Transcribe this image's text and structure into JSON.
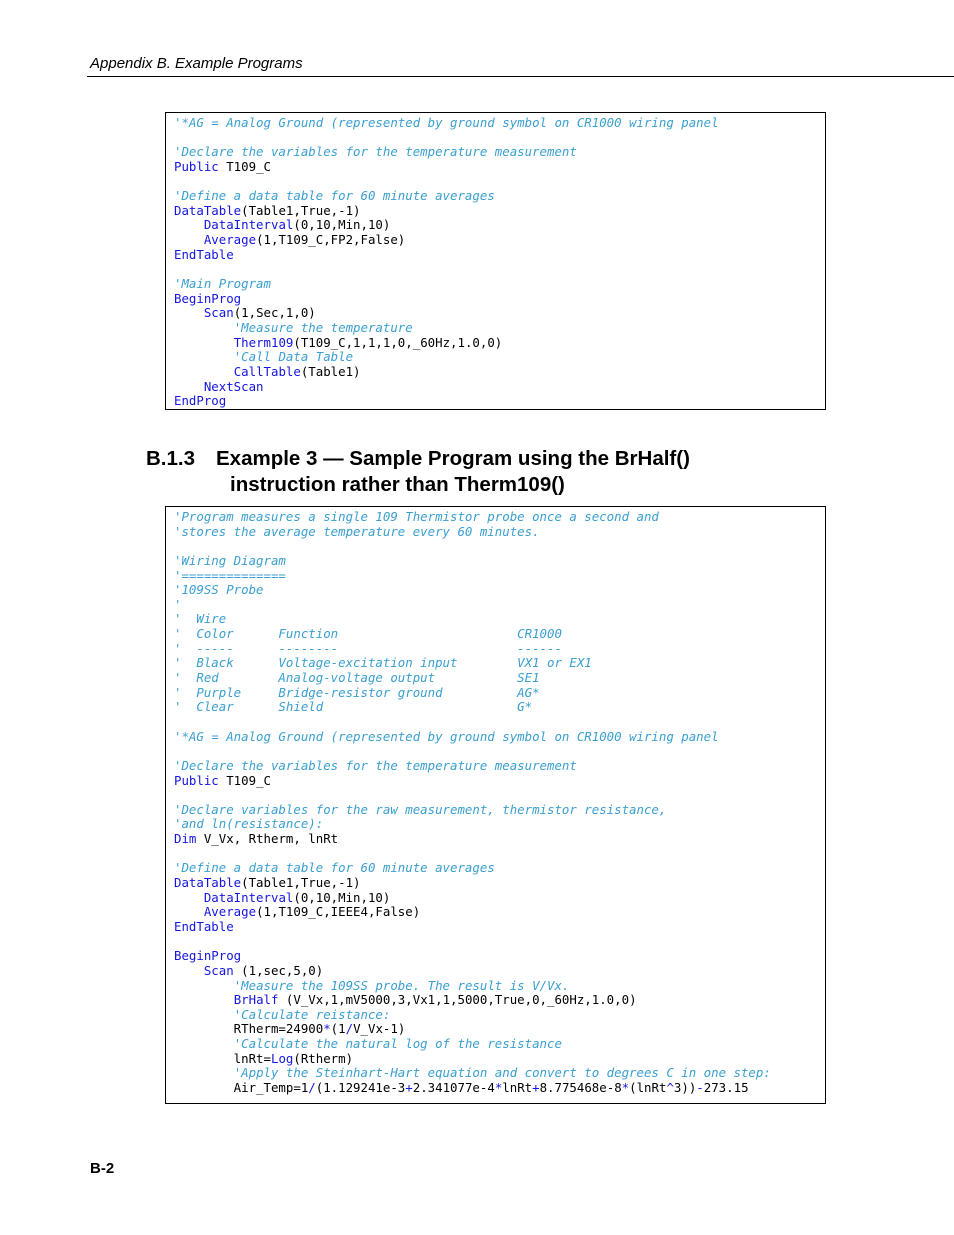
{
  "header": {
    "running_title": "Appendix B.  Example Programs"
  },
  "section": {
    "number": "B.1.3",
    "title_line1": "Example 3 — Sample Program using the BrHalf()",
    "title_line2": "instruction rather than Therm109()"
  },
  "footer": {
    "page_number": "B-2"
  },
  "colors": {
    "comment": "#3a9fd0",
    "keyword": "#1515e0",
    "text": "#000000"
  },
  "code_block_1": [
    [
      [
        "c",
        "'*AG = Analog Ground (represented by ground symbol on CR1000 wiring panel"
      ]
    ],
    [],
    [
      [
        "c",
        "'Declare the variables for the temperature measurement"
      ]
    ],
    [
      [
        "k",
        "Public"
      ],
      [
        "t",
        " T109_C"
      ]
    ],
    [],
    [
      [
        "c",
        "'Define a data table for 60 minute averages"
      ]
    ],
    [
      [
        "k",
        "DataTable"
      ],
      [
        "t",
        "(Table1,True,-1)"
      ]
    ],
    [
      [
        "t",
        "    "
      ],
      [
        "k",
        "DataInterval"
      ],
      [
        "t",
        "(0,10,Min,10)"
      ]
    ],
    [
      [
        "t",
        "    "
      ],
      [
        "k",
        "Average"
      ],
      [
        "t",
        "(1,T109_C,FP2,False)"
      ]
    ],
    [
      [
        "k",
        "EndTable"
      ]
    ],
    [],
    [
      [
        "c",
        "'Main Program"
      ]
    ],
    [
      [
        "k",
        "BeginProg"
      ]
    ],
    [
      [
        "t",
        "    "
      ],
      [
        "k",
        "Scan"
      ],
      [
        "t",
        "(1,Sec,1,0)"
      ]
    ],
    [
      [
        "t",
        "        "
      ],
      [
        "c",
        "'Measure the temperature"
      ]
    ],
    [
      [
        "t",
        "        "
      ],
      [
        "k",
        "Therm109"
      ],
      [
        "t",
        "(T109_C,1,1,1,0,_60Hz,1.0,0)"
      ]
    ],
    [
      [
        "t",
        "        "
      ],
      [
        "c",
        "'Call Data Table"
      ]
    ],
    [
      [
        "t",
        "        "
      ],
      [
        "k",
        "CallTable"
      ],
      [
        "t",
        "(Table1)"
      ]
    ],
    [
      [
        "t",
        "    "
      ],
      [
        "k",
        "NextScan"
      ]
    ],
    [
      [
        "k",
        "EndProg"
      ]
    ]
  ],
  "code_block_2": [
    [
      [
        "c",
        "'Program measures a single 109 Thermistor probe once a second and"
      ]
    ],
    [
      [
        "c",
        "'stores the average temperature every 60 minutes."
      ]
    ],
    [],
    [
      [
        "c",
        "'Wiring Diagram"
      ]
    ],
    [
      [
        "c",
        "'=============="
      ]
    ],
    [
      [
        "c",
        "'109SS Probe"
      ]
    ],
    [
      [
        "c",
        "'"
      ]
    ],
    [
      [
        "c",
        "'  Wire"
      ]
    ],
    [
      [
        "c",
        "'  Color      Function                        CR1000"
      ]
    ],
    [
      [
        "c",
        "'  -----      --------                        ------"
      ]
    ],
    [
      [
        "c",
        "'  Black      Voltage-excitation input        VX1 or EX1"
      ]
    ],
    [
      [
        "c",
        "'  Red        Analog-voltage output           SE1"
      ]
    ],
    [
      [
        "c",
        "'  Purple     Bridge-resistor ground          AG*"
      ]
    ],
    [
      [
        "c",
        "'  Clear      Shield                          G*"
      ]
    ],
    [],
    [
      [
        "c",
        "'*AG = Analog Ground (represented by ground symbol on CR1000 wiring panel"
      ]
    ],
    [],
    [
      [
        "c",
        "'Declare the variables for the temperature measurement"
      ]
    ],
    [
      [
        "k",
        "Public"
      ],
      [
        "t",
        " T109_C"
      ]
    ],
    [],
    [
      [
        "c",
        "'Declare variables for the raw measurement, thermistor resistance,"
      ]
    ],
    [
      [
        "c",
        "'and ln(resistance):"
      ]
    ],
    [
      [
        "k",
        "Dim"
      ],
      [
        "t",
        " V_Vx, Rtherm, lnRt"
      ]
    ],
    [],
    [
      [
        "c",
        "'Define a data table for 60 minute averages"
      ]
    ],
    [
      [
        "k",
        "DataTable"
      ],
      [
        "t",
        "(Table1,True,-1)"
      ]
    ],
    [
      [
        "t",
        "    "
      ],
      [
        "k",
        "DataInterval"
      ],
      [
        "t",
        "(0,10,Min,10)"
      ]
    ],
    [
      [
        "t",
        "    "
      ],
      [
        "k",
        "Average"
      ],
      [
        "t",
        "(1,T109_C,IEEE4,False)"
      ]
    ],
    [
      [
        "k",
        "EndTable"
      ]
    ],
    [],
    [
      [
        "k",
        "BeginProg"
      ]
    ],
    [
      [
        "t",
        "    "
      ],
      [
        "k",
        "Scan"
      ],
      [
        "t",
        " (1,sec,5,0)"
      ]
    ],
    [
      [
        "t",
        "        "
      ],
      [
        "c",
        "'Measure the 109SS probe. The result is V/Vx."
      ]
    ],
    [
      [
        "t",
        "        "
      ],
      [
        "k",
        "BrHalf"
      ],
      [
        "t",
        " (V_Vx,1,mV5000,3,Vx1,1,5000,True,0,_60Hz,1.0,0)"
      ]
    ],
    [
      [
        "t",
        "        "
      ],
      [
        "c",
        "'Calculate reistance:"
      ]
    ],
    [
      [
        "t",
        "        RTherm=24900"
      ],
      [
        "o",
        "*"
      ],
      [
        "t",
        "(1"
      ],
      [
        "o",
        "/"
      ],
      [
        "t",
        "V_Vx-1)"
      ]
    ],
    [
      [
        "t",
        "        "
      ],
      [
        "c",
        "'Calculate the natural log of the resistance"
      ]
    ],
    [
      [
        "t",
        "        lnRt="
      ],
      [
        "k",
        "Log"
      ],
      [
        "t",
        "(Rtherm)"
      ]
    ],
    [
      [
        "t",
        "        "
      ],
      [
        "c",
        "'Apply the Steinhart-Hart equation and convert to degrees C in one step:"
      ]
    ],
    [
      [
        "t",
        "        Air_Temp=1"
      ],
      [
        "o",
        "/"
      ],
      [
        "t",
        "(1.129241e-3"
      ],
      [
        "o",
        "+"
      ],
      [
        "t",
        "2.341077e-4"
      ],
      [
        "o",
        "*"
      ],
      [
        "t",
        "lnRt"
      ],
      [
        "o",
        "+"
      ],
      [
        "t",
        "8.775468e-8"
      ],
      [
        "o",
        "*"
      ],
      [
        "t",
        "(lnRt"
      ],
      [
        "o",
        "^"
      ],
      [
        "t",
        "3))"
      ],
      [
        "o",
        "-"
      ],
      [
        "t",
        "273.15"
      ]
    ]
  ]
}
